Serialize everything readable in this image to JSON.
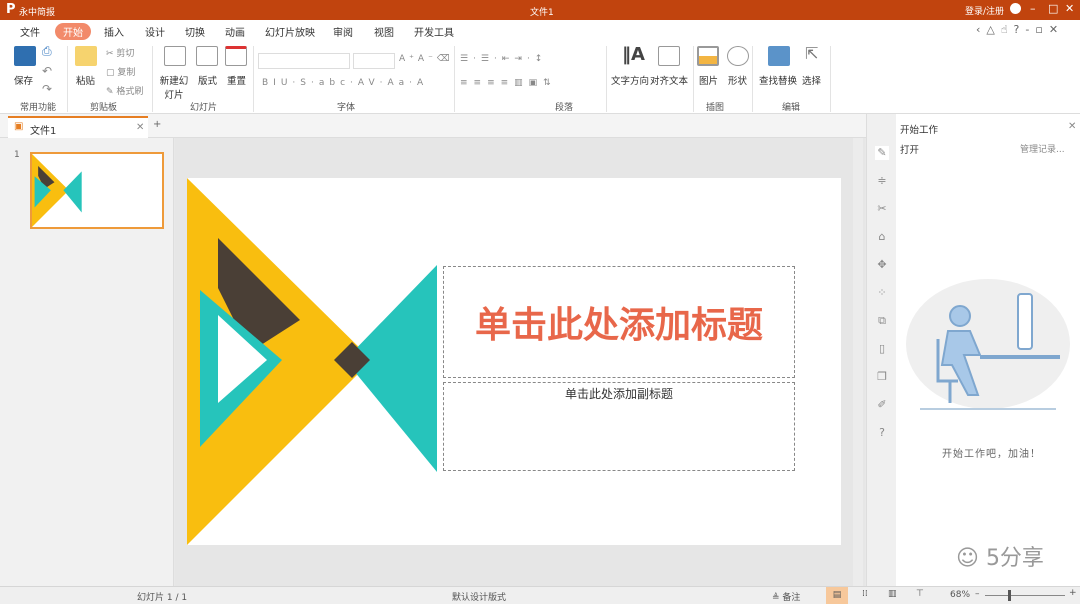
{
  "app": {
    "name": "永中简报",
    "doc_title": "文件1",
    "login": "登录/注册"
  },
  "menu": [
    "文件",
    "开始",
    "插入",
    "设计",
    "切换",
    "动画",
    "幻灯片放映",
    "审阅",
    "视图",
    "开发工具"
  ],
  "ribbon": {
    "groups": {
      "common": "常用功能",
      "clipboard": "剪贴板",
      "slides": "幻灯片",
      "font": "字体",
      "paragraph": "段落",
      "illustration": "插图",
      "edit": "编辑"
    },
    "save": "保存",
    "paste": "粘贴",
    "cut": "剪切",
    "copy": "复制",
    "format_painter": "格式刷",
    "new_slide": "新建幻灯片",
    "layout": "版式",
    "reset": "重置",
    "text_direction": "文字方向",
    "align_text": "对齐文本",
    "picture": "图片",
    "shape": "形状",
    "find_replace": "查找替换",
    "select": "选择"
  },
  "doc_tab": "文件1",
  "slide_number": "1",
  "slide": {
    "title_placeholder": "单击此处添加标题",
    "subtitle_placeholder": "单击此处添加副标题",
    "colors": {
      "yellow": "#f9be0f",
      "teal": "#26c4bb",
      "dark": "#4a3f36",
      "title": "#e8674a"
    }
  },
  "panel": {
    "title": "开始工作",
    "open": "打开",
    "manage": "管理记录...",
    "message": "开始工作吧，加油！"
  },
  "status": {
    "slide_label": "幻灯片 1 / 1",
    "design": "默认设计版式",
    "notes": "备注",
    "zoom": "68%"
  },
  "watermark": "5分享"
}
